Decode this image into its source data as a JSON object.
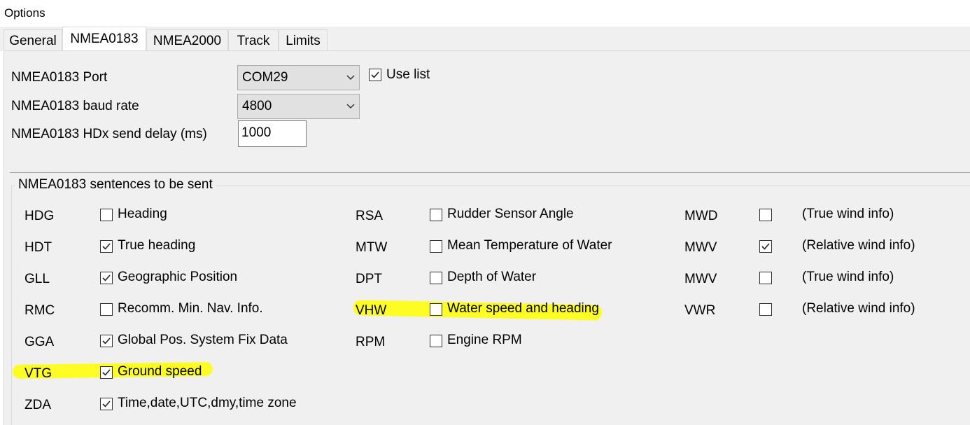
{
  "window": {
    "title": "Options"
  },
  "tabs": [
    {
      "label": "General",
      "active": false
    },
    {
      "label": "NMEA0183",
      "active": true
    },
    {
      "label": "NMEA2000",
      "active": false
    },
    {
      "label": "Track",
      "active": false
    },
    {
      "label": "Limits",
      "active": false
    }
  ],
  "port": {
    "port_label": "NMEA0183 Port",
    "port_value": "COM29",
    "use_list_label": "Use list",
    "use_list_checked": true,
    "baud_label": "NMEA0183 baud rate",
    "baud_value": "4800",
    "delay_label": "NMEA0183 HDx send delay (ms)",
    "delay_value": "1000"
  },
  "sentences": {
    "group_title": "NMEA0183 sentences to be sent",
    "col1": [
      {
        "code": "HDG",
        "desc": "Heading",
        "checked": false
      },
      {
        "code": "HDT",
        "desc": "True heading",
        "checked": true
      },
      {
        "code": "GLL",
        "desc": "Geographic Position",
        "checked": true
      },
      {
        "code": "RMC",
        "desc": "Recomm. Min. Nav. Info.",
        "checked": false
      },
      {
        "code": "GGA",
        "desc": "Global Pos. System Fix Data",
        "checked": true
      },
      {
        "code": "VTG",
        "desc": "Ground speed",
        "checked": true
      },
      {
        "code": "ZDA",
        "desc": "Time,date,UTC,dmy,time zone",
        "checked": true
      }
    ],
    "col2": [
      {
        "code": "RSA",
        "desc": "Rudder Sensor Angle",
        "checked": false
      },
      {
        "code": "MTW",
        "desc": "Mean Temperature of Water",
        "checked": false
      },
      {
        "code": "DPT",
        "desc": "Depth of Water",
        "checked": false
      },
      {
        "code": "VHW",
        "desc": "Water speed and heading",
        "checked": false
      },
      {
        "code": "RPM",
        "desc": "Engine RPM",
        "checked": false
      }
    ],
    "col3": [
      {
        "code": "MWD",
        "desc": "(True wind info)",
        "checked": false
      },
      {
        "code": "MWV",
        "desc": "(Relative wind info)",
        "checked": true
      },
      {
        "code": "MWV",
        "desc": "(True wind info)",
        "checked": false
      },
      {
        "code": "VWR",
        "desc": "(Relative wind info)",
        "checked": false
      }
    ]
  },
  "colors": {
    "highlight": "#ffff00",
    "panel_bg": "#f0f0f0"
  }
}
